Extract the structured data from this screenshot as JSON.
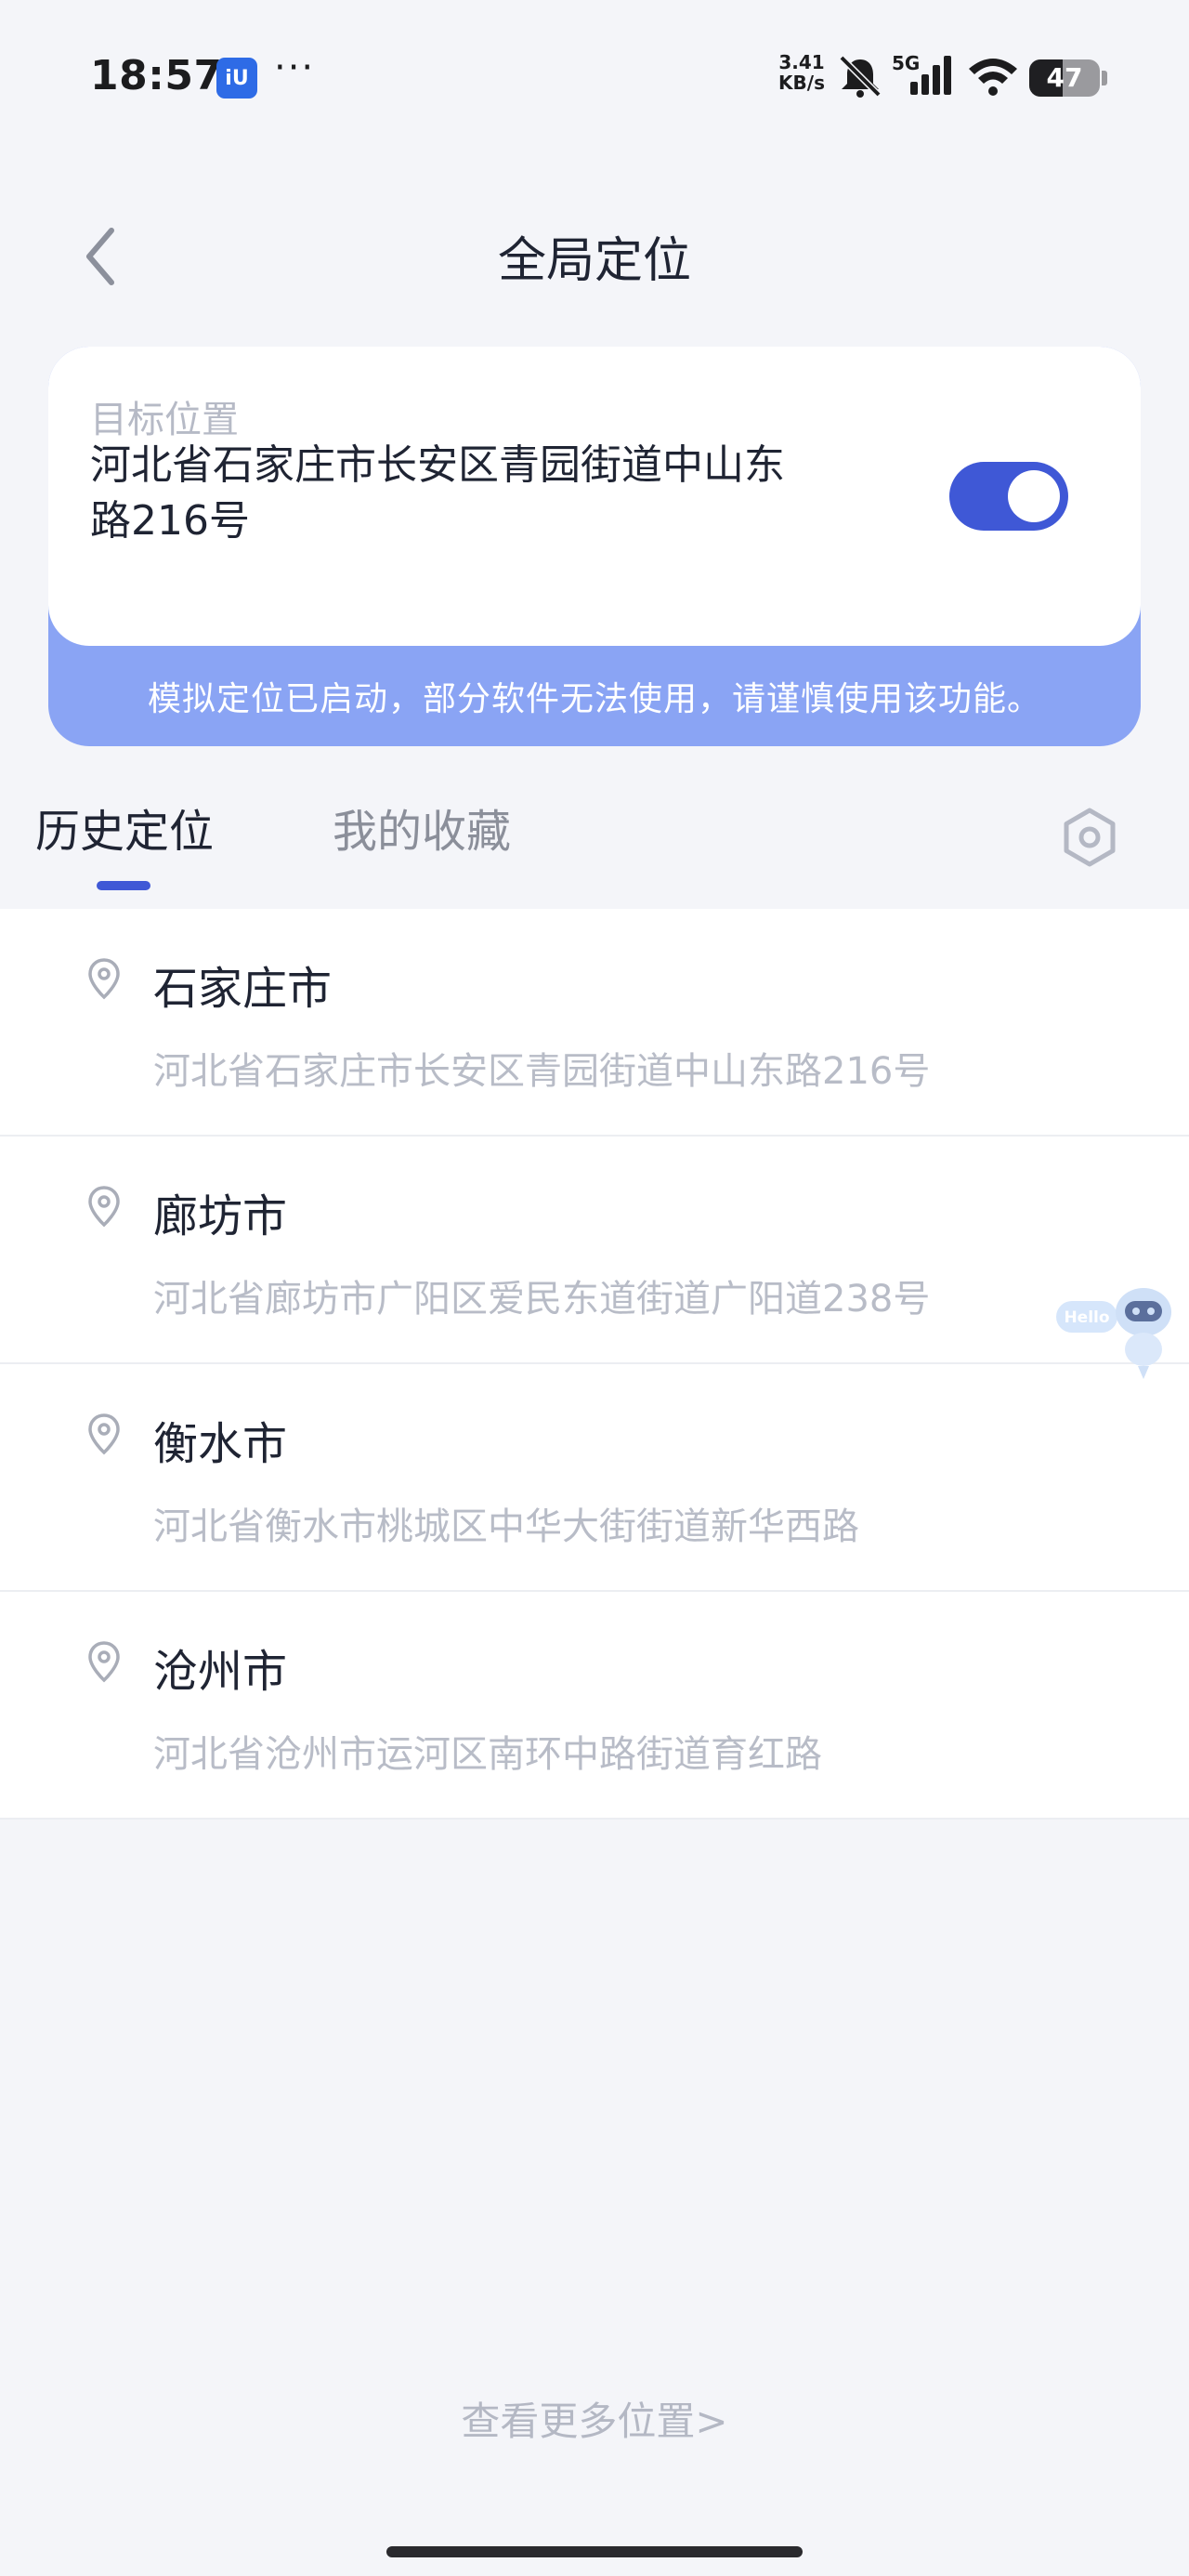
{
  "status_bar": {
    "time": "18:57",
    "app_badge": "iU",
    "more": "···",
    "net_speed_value": "3.41",
    "net_speed_unit": "KB/s",
    "network": "5G",
    "battery": "47",
    "battery_level": 0.47
  },
  "header": {
    "title": "全局定位",
    "back_icon": "chevron-left-icon"
  },
  "target_card": {
    "label": "目标位置",
    "address": "河北省石家庄市长安区青园街道中山东路216号",
    "toggle_on": true,
    "notice": "模拟定位已启动，部分软件无法使用，请谨慎使用该功能。",
    "accent_color": "#3f58d6",
    "banner_color": "#8aa4f4"
  },
  "tabs": [
    {
      "label": "历史定位",
      "active": true
    },
    {
      "label": "我的收藏",
      "active": false
    }
  ],
  "settings_icon": "hexagon-settings-icon",
  "history": [
    {
      "name": "石家庄市",
      "address": "河北省石家庄市长安区青园街道中山东路216号"
    },
    {
      "name": "廊坊市",
      "address": "河北省廊坊市广阳区爱民东道街道广阳道238号"
    },
    {
      "name": "衡水市",
      "address": "河北省衡水市桃城区中华大街街道新华西路"
    },
    {
      "name": "沧州市",
      "address": "河北省沧州市运河区南环中路街道育红路"
    }
  ],
  "assistant": {
    "text": "Hello",
    "icon": "robot-assistant-icon"
  },
  "more_link": "查看更多位置>"
}
